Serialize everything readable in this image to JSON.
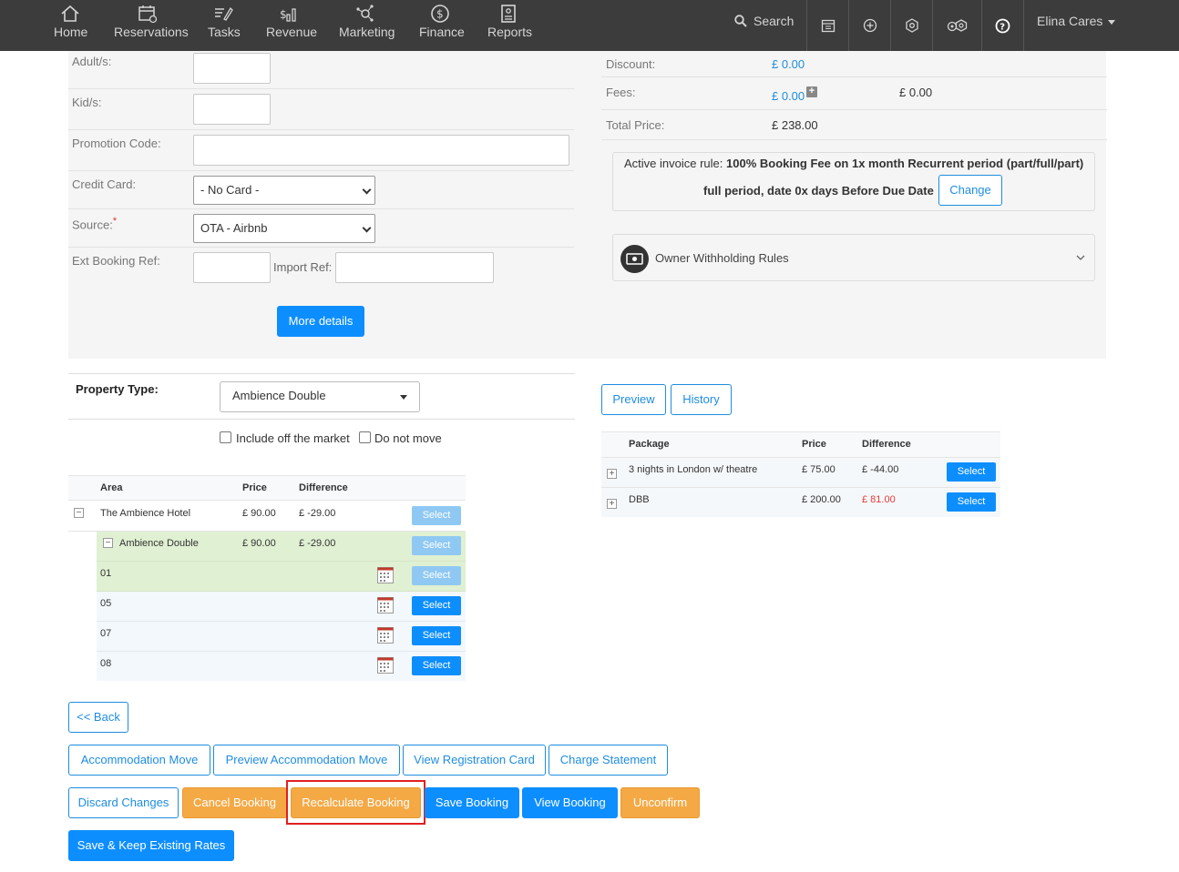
{
  "nav": {
    "items": [
      {
        "label": "Home",
        "icon": "home-icon"
      },
      {
        "label": "Reservations",
        "icon": "calendar-icon"
      },
      {
        "label": "Tasks",
        "icon": "tasks-icon"
      },
      {
        "label": "Revenue",
        "icon": "revenue-icon"
      },
      {
        "label": "Marketing",
        "icon": "marketing-icon"
      },
      {
        "label": "Finance",
        "icon": "finance-icon"
      },
      {
        "label": "Reports",
        "icon": "reports-icon"
      }
    ],
    "search_label": "Search",
    "user_name": "Elina Cares"
  },
  "form": {
    "adults_label": "Adult/s:",
    "kids_label": "Kid/s:",
    "promo_label": "Promotion Code:",
    "card_label": "Credit Card:",
    "card_value": "- No Card -",
    "source_label": "Source:",
    "source_required": "*",
    "source_value": "OTA - Airbnb",
    "ext_ref_label": "Ext Booking Ref:",
    "import_ref_label": "Import Ref:",
    "more_details": "More details"
  },
  "pricing": {
    "discount_label": "Discount:",
    "discount_value": "£ 0.00",
    "fees_label": "Fees:",
    "fees_value": "£ 0.00",
    "fees_value2": "£ 0.00",
    "total_label": "Total Price:",
    "total_value": "£ 238.00",
    "rule_prefix": "Active invoice rule:",
    "rule_text_1": "100% Booking Fee on 1x month Recurrent period (part/full/part)",
    "rule_text_2": "full period, date 0x days Before Due Date",
    "change_button": "Change",
    "withholding_label": "Owner Withholding Rules"
  },
  "property": {
    "type_label": "Property Type:",
    "type_value": "Ambience Double",
    "off_market_label": "Include off the market",
    "do_not_move_label": "Do not move"
  },
  "area_table": {
    "headers": [
      "Area",
      "Price",
      "Difference"
    ],
    "select_label": "Select",
    "rows": [
      {
        "name": "The Ambience Hotel",
        "price": "£ 90.00",
        "diff": "£ -29.00"
      },
      {
        "name": "Ambience Double",
        "price": "£ 90.00",
        "diff": "£ -29.00"
      },
      {
        "name": "01"
      },
      {
        "name": "05"
      },
      {
        "name": "07"
      },
      {
        "name": "08"
      }
    ]
  },
  "package_table": {
    "preview_button": "Preview",
    "history_button": "History",
    "headers": [
      "Package",
      "Price",
      "Difference"
    ],
    "select_label": "Select",
    "rows": [
      {
        "name": "3 nights in London w/ theatre",
        "price": "£ 75.00",
        "diff": "£ -44.00"
      },
      {
        "name": "DBB",
        "price": "£ 200.00",
        "diff": "£ 81.00"
      }
    ]
  },
  "actions": {
    "back": "<< Back",
    "accommodation_move": "Accommodation Move",
    "preview_accommodation_move": "Preview Accommodation Move",
    "view_registration_card": "View Registration Card",
    "charge_statement": "Charge Statement",
    "discard_changes": "Discard Changes",
    "cancel_booking": "Cancel Booking",
    "recalculate_booking": "Recalculate Booking",
    "save_booking": "Save Booking",
    "view_booking": "View Booking",
    "unconfirm": "Unconfirm",
    "save_keep_rates": "Save & Keep Existing Rates"
  },
  "colors": {
    "primary": "#0d8eff",
    "outline": "#1e8ddf",
    "warning": "#f4a945",
    "highlight": "#e02020",
    "negative": "#e53935",
    "selected_row": "#e0f0d2"
  }
}
